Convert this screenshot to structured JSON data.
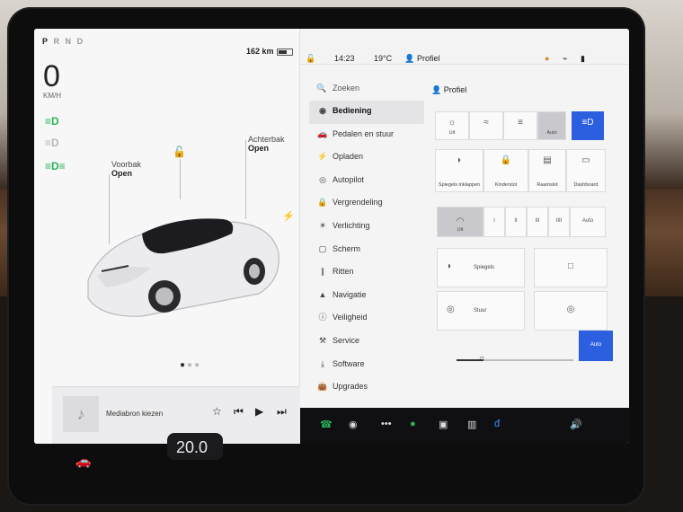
{
  "gear": {
    "letters": [
      "P",
      "R",
      "N",
      "D"
    ],
    "active": "P"
  },
  "left": {
    "range": "162 km",
    "speed": "0",
    "speed_unit": "KM/H",
    "frunk": {
      "label": "Voorbak",
      "state": "Open"
    },
    "trunk": {
      "label": "Achterbak",
      "state": "Open"
    },
    "media_label": "Mediabron kiezen"
  },
  "status": {
    "time": "14:23",
    "temp": "19°C",
    "profile": "Profiel"
  },
  "menu": {
    "search": "Zoeken",
    "items": [
      {
        "label": "Bediening",
        "icon": "toggle-icon",
        "active": true
      },
      {
        "label": "Pedalen en stuur",
        "icon": "car-icon"
      },
      {
        "label": "Opladen",
        "icon": "bolt-icon"
      },
      {
        "label": "Autopilot",
        "icon": "steering-wheel-icon"
      },
      {
        "label": "Vergrendeling",
        "icon": "lock-icon"
      },
      {
        "label": "Verlichting",
        "icon": "sun-icon"
      },
      {
        "label": "Scherm",
        "icon": "screen-icon"
      },
      {
        "label": "Ritten",
        "icon": "trips-icon"
      },
      {
        "label": "Navigatie",
        "icon": "navigation-icon"
      },
      {
        "label": "Veiligheid",
        "icon": "info-icon"
      },
      {
        "label": "Service",
        "icon": "wrench-icon"
      },
      {
        "label": "Software",
        "icon": "download-icon"
      },
      {
        "label": "Upgrades",
        "icon": "bag-icon"
      }
    ]
  },
  "panel": {
    "profile": "Profiel",
    "lights": [
      "Uit",
      "",
      "",
      "Auto"
    ],
    "row2": [
      "Spiegels inklappen",
      "Kinderslot",
      "Raamslot",
      "Dashboard"
    ],
    "wipers": [
      "Uit",
      "I",
      "II",
      "III",
      "IIII",
      "Auto"
    ],
    "mirror_label": "Spiegels",
    "steer_label": "Stuur",
    "auto_label": "Auto"
  },
  "dock": {
    "cabin_temp": "20.0"
  },
  "colors": {
    "accent": "#2c5fe0",
    "telltale_green": "#2bb15a"
  }
}
